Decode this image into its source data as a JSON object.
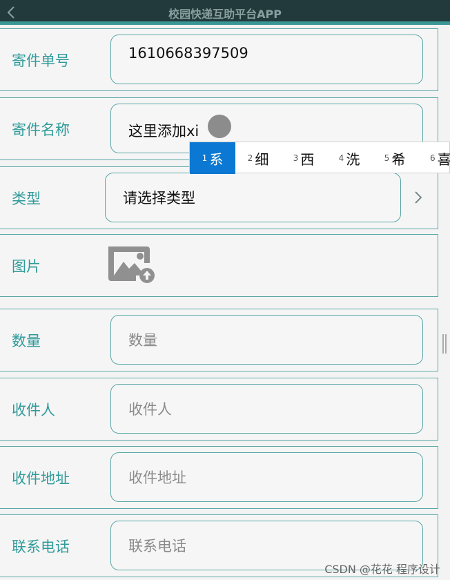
{
  "header": {
    "title": "校园快递互助平台APP"
  },
  "form": {
    "tracking": {
      "label": "寄件单号",
      "value": "1610668397509"
    },
    "name": {
      "label": "寄件名称",
      "value": "这里添加xi"
    },
    "type": {
      "label": "类型",
      "value": "请选择类型"
    },
    "image": {
      "label": "图片"
    },
    "quantity": {
      "label": "数量",
      "placeholder": "数量"
    },
    "receiver": {
      "label": "收件人",
      "placeholder": "收件人"
    },
    "address": {
      "label": "收件地址",
      "placeholder": "收件地址"
    },
    "phone": {
      "label": "联系电话",
      "placeholder": "联系电话"
    }
  },
  "ime": {
    "candidates": [
      {
        "num": "1",
        "char": "系"
      },
      {
        "num": "2",
        "char": "细"
      },
      {
        "num": "3",
        "char": "西"
      },
      {
        "num": "4",
        "char": "洗"
      },
      {
        "num": "5",
        "char": "希"
      },
      {
        "num": "6",
        "char": "喜"
      }
    ]
  },
  "watermark": "CSDN @花花 程序设计",
  "colors": {
    "accent": "#2f9b9a",
    "header_bg": "#233a3c",
    "ime_selected": "#0b78d3"
  }
}
